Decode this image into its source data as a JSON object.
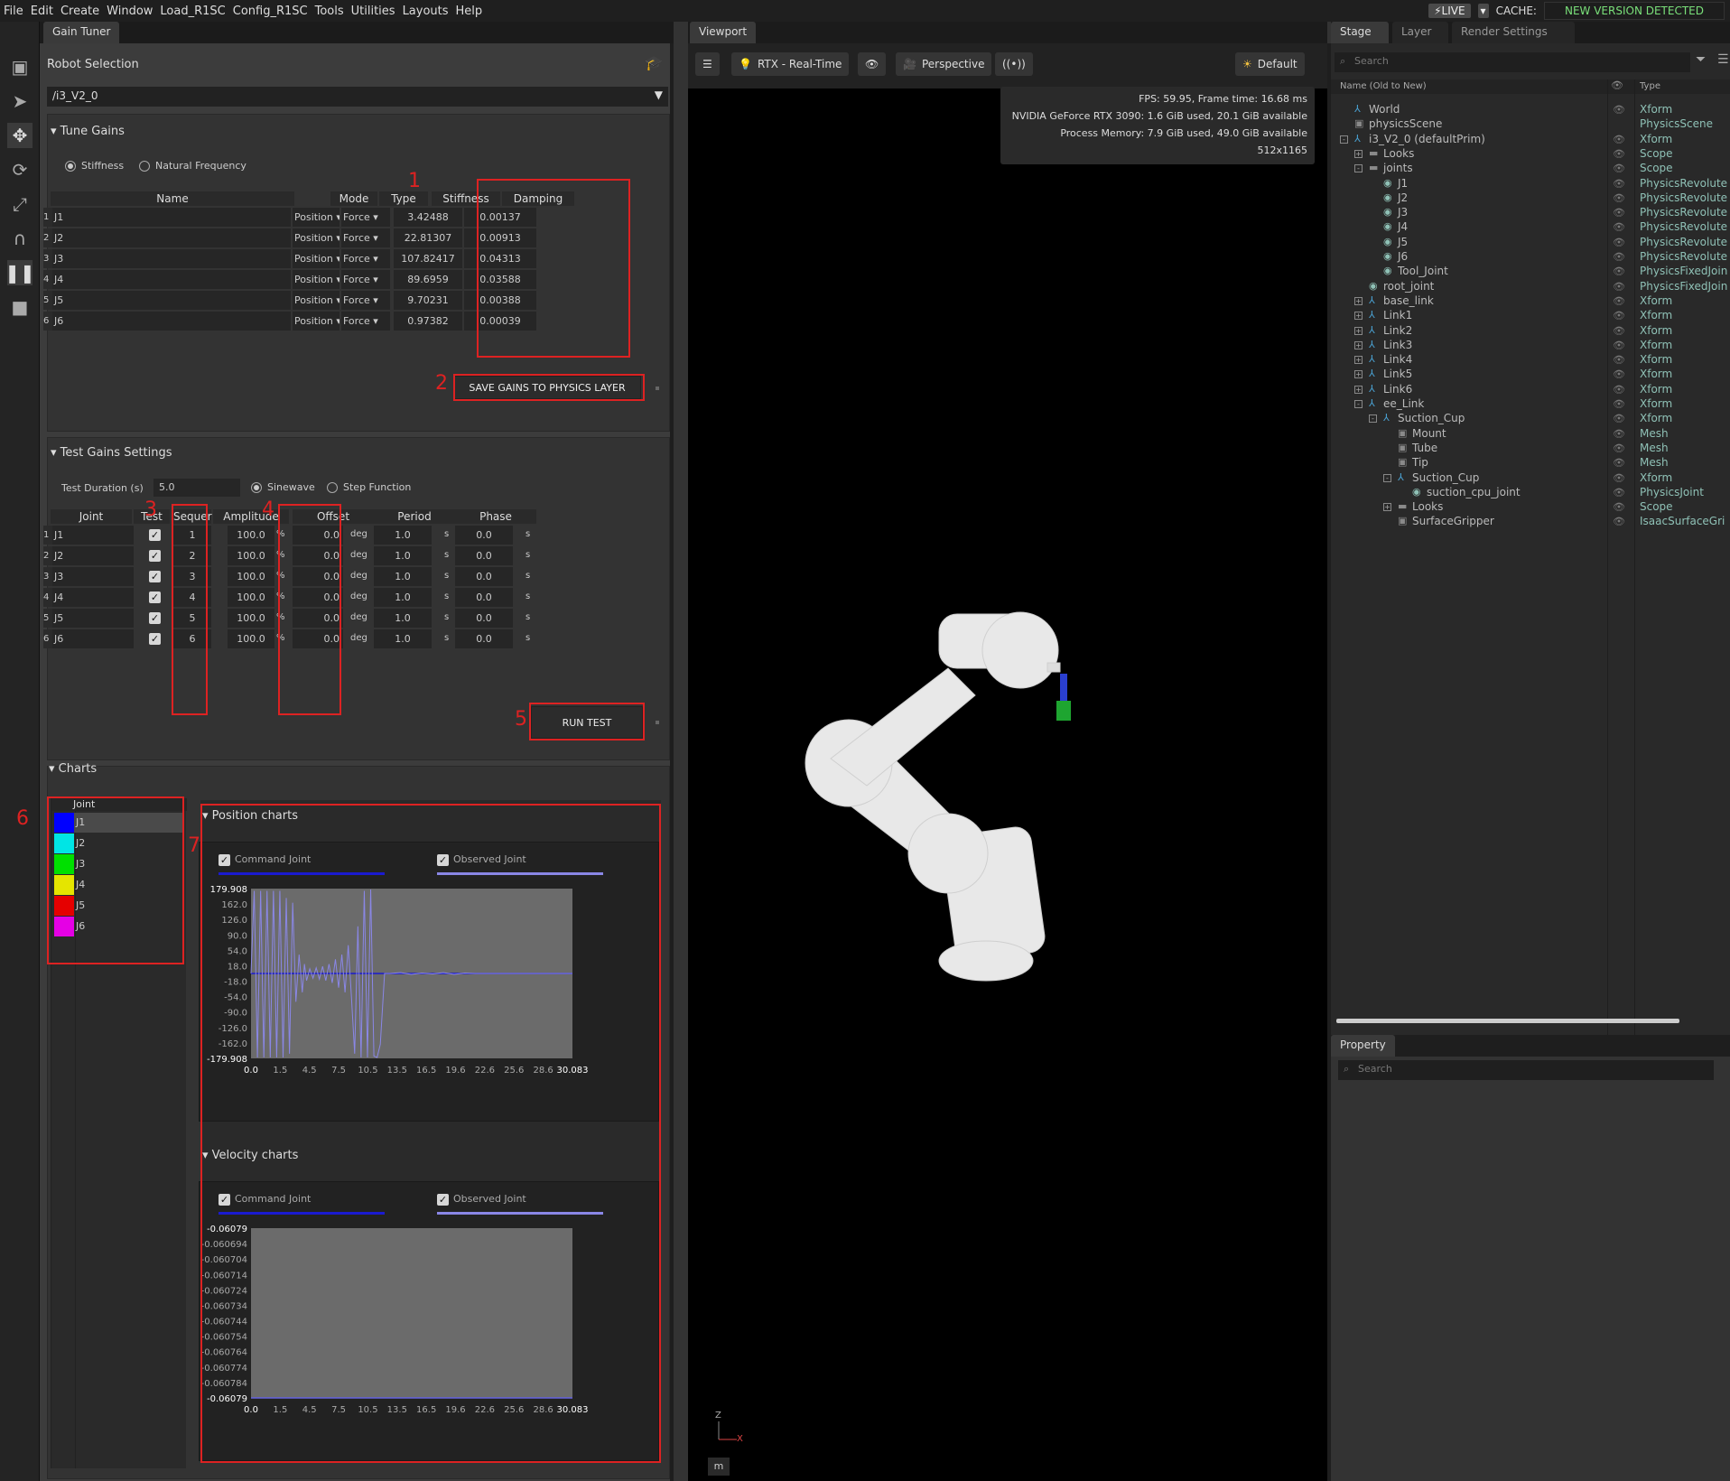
{
  "menu": [
    "File",
    "Edit",
    "Create",
    "Window",
    "Load_R1SC",
    "Config_R1SC",
    "Tools",
    "Utilities",
    "Layouts",
    "Help"
  ],
  "live": {
    "label": "LIVE",
    "cache": "CACHE:",
    "new_version": "NEW VERSION DETECTED"
  },
  "gain_tuner": {
    "tab": "Gain Tuner",
    "robot_selection_label": "Robot Selection",
    "robot": "/i3_V2_0",
    "tune_gains": {
      "title": "Tune Gains",
      "radio_stiffness": "Stiffness",
      "radio_natural": "Natural Frequency",
      "headers": {
        "name": "Name",
        "mode": "Mode",
        "type": "Type",
        "stiffness": "Stiffness",
        "damping": "Damping"
      },
      "rows": [
        {
          "idx": "1",
          "name": "J1",
          "mode": "Position",
          "type": "Force",
          "stiffness": "3.42488",
          "damping": "0.00137"
        },
        {
          "idx": "2",
          "name": "J2",
          "mode": "Position",
          "type": "Force",
          "stiffness": "22.81307",
          "damping": "0.00913"
        },
        {
          "idx": "3",
          "name": "J3",
          "mode": "Position",
          "type": "Force",
          "stiffness": "107.82417",
          "damping": "0.04313"
        },
        {
          "idx": "4",
          "name": "J4",
          "mode": "Position",
          "type": "Force",
          "stiffness": "89.6959",
          "damping": "0.03588"
        },
        {
          "idx": "5",
          "name": "J5",
          "mode": "Position",
          "type": "Force",
          "stiffness": "9.70231",
          "damping": "0.00388"
        },
        {
          "idx": "6",
          "name": "J6",
          "mode": "Position",
          "type": "Force",
          "stiffness": "0.97382",
          "damping": "0.00039"
        }
      ],
      "save_button": "SAVE GAINS TO PHYSICS LAYER"
    },
    "test_gains": {
      "title": "Test Gains Settings",
      "duration_label": "Test Duration (s)",
      "duration": "5.0",
      "radio_sine": "Sinewave",
      "radio_step": "Step Function",
      "headers": {
        "joint": "Joint",
        "test": "Test",
        "sequence": "Sequer",
        "amplitude": "Amplitude",
        "offset": "Offset",
        "period": "Period",
        "phase": "Phase"
      },
      "rows": [
        {
          "idx": "1",
          "joint": "J1",
          "seq": "1",
          "amp": "100.0",
          "amp_unit": "%",
          "offset": "0.0",
          "offset_unit": "deg",
          "period": "1.0",
          "period_unit": "s",
          "phase": "0.0",
          "phase_unit": "s"
        },
        {
          "idx": "2",
          "joint": "J2",
          "seq": "2",
          "amp": "100.0",
          "amp_unit": "%",
          "offset": "0.0",
          "offset_unit": "deg",
          "period": "1.0",
          "period_unit": "s",
          "phase": "0.0",
          "phase_unit": "s"
        },
        {
          "idx": "3",
          "joint": "J3",
          "seq": "3",
          "amp": "100.0",
          "amp_unit": "%",
          "offset": "0.0",
          "offset_unit": "deg",
          "period": "1.0",
          "period_unit": "s",
          "phase": "0.0",
          "phase_unit": "s"
        },
        {
          "idx": "4",
          "joint": "J4",
          "seq": "4",
          "amp": "100.0",
          "amp_unit": "%",
          "offset": "0.0",
          "offset_unit": "deg",
          "period": "1.0",
          "period_unit": "s",
          "phase": "0.0",
          "phase_unit": "s"
        },
        {
          "idx": "5",
          "joint": "J5",
          "seq": "5",
          "amp": "100.0",
          "amp_unit": "%",
          "offset": "0.0",
          "offset_unit": "deg",
          "period": "1.0",
          "period_unit": "s",
          "phase": "0.0",
          "phase_unit": "s"
        },
        {
          "idx": "6",
          "joint": "J6",
          "seq": "6",
          "amp": "100.0",
          "amp_unit": "%",
          "offset": "0.0",
          "offset_unit": "deg",
          "period": "1.0",
          "period_unit": "s",
          "phase": "0.0",
          "phase_unit": "s"
        }
      ],
      "run_button": "RUN TEST"
    },
    "charts": {
      "title": "Charts",
      "joint_header": "Joint",
      "joints": [
        {
          "name": "J1",
          "color": "#0000ff"
        },
        {
          "name": "J2",
          "color": "#00e5e5"
        },
        {
          "name": "J3",
          "color": "#00e000"
        },
        {
          "name": "J4",
          "color": "#e5e500"
        },
        {
          "name": "J5",
          "color": "#e50000"
        },
        {
          "name": "J6",
          "color": "#e500e5"
        }
      ],
      "position_title": "Position charts",
      "velocity_title": "Velocity charts",
      "legend_command": "Command Joint",
      "legend_observed": "Observed Joint"
    },
    "annotations": [
      "1",
      "2",
      "3",
      "4",
      "5",
      "6",
      "7"
    ]
  },
  "chart_data": [
    {
      "type": "line",
      "title": "Position charts",
      "y_max_label": "179.908",
      "y_min_label": "-179.908",
      "y_ticks": [
        "162.0",
        "126.0",
        "90.0",
        "54.0",
        "18.0",
        "-18.0",
        "-54.0",
        "-90.0",
        "-126.0",
        "-162.0"
      ],
      "x_ticks": [
        "0.0",
        "1.5",
        "4.5",
        "7.5",
        "10.5",
        "13.5",
        "16.5",
        "19.6",
        "22.6",
        "25.6",
        "28.6",
        "30.083"
      ],
      "ylim": [
        -179.908,
        179.908
      ],
      "xlim": [
        0.0,
        30.083
      ],
      "series": [
        {
          "name": "Command Joint",
          "color": "#1a1ad0",
          "x": [
            0,
            30.083
          ],
          "y": [
            0,
            0
          ]
        },
        {
          "name": "Observed Joint",
          "color": "#8a87e6",
          "x": [
            0.0,
            0.3,
            0.6,
            0.9,
            1.2,
            1.5,
            1.8,
            2.1,
            2.4,
            2.7,
            3.0,
            3.3,
            3.6,
            3.9,
            4.2,
            4.5,
            4.8,
            5.0,
            5.2,
            5.5,
            5.8,
            6.1,
            6.4,
            6.7,
            7.0,
            7.3,
            7.6,
            7.9,
            8.2,
            8.5,
            8.8,
            9.1,
            9.4,
            9.7,
            10.0,
            10.3,
            10.6,
            10.9,
            11.2,
            11.5,
            11.8,
            12.1,
            12.5,
            13.0,
            14.0,
            15.0,
            16.0,
            17.0,
            18.0,
            19.0,
            20.0,
            21.0,
            22.0,
            23.0,
            24.0,
            25.0,
            26.0,
            27.0,
            28.0,
            29.0,
            30.083
          ],
          "y": [
            0,
            175,
            -178,
            175,
            -178,
            175,
            -178,
            175,
            -178,
            175,
            -178,
            160,
            -170,
            150,
            -60,
            40,
            -40,
            20,
            -15,
            10,
            -10,
            12,
            -12,
            15,
            -15,
            20,
            -20,
            30,
            -30,
            40,
            -40,
            60,
            -50,
            -170,
            100,
            -178,
            175,
            -178,
            178,
            -175,
            -178,
            -150,
            0,
            0,
            2,
            -2,
            1,
            -1,
            2,
            -2,
            1,
            0,
            0,
            0,
            0,
            0,
            0,
            0,
            0,
            0,
            0
          ]
        }
      ]
    },
    {
      "type": "line",
      "title": "Velocity charts",
      "y_max_label": "-0.06079",
      "y_min_label": "-0.06079",
      "y_ticks": [
        "-0.060694",
        "-0.060704",
        "-0.060714",
        "-0.060724",
        "-0.060734",
        "-0.060744",
        "-0.060754",
        "-0.060764",
        "-0.060774",
        "-0.060784"
      ],
      "x_ticks": [
        "0.0",
        "1.5",
        "4.5",
        "7.5",
        "10.5",
        "13.5",
        "16.5",
        "19.6",
        "22.6",
        "25.6",
        "28.6",
        "30.083"
      ],
      "ylim": [
        -0.06079,
        -0.060684
      ],
      "xlim": [
        0.0,
        30.083
      ],
      "series": [
        {
          "name": "Command Joint",
          "color": "#1a1ad0",
          "x": [
            0,
            30.083
          ],
          "y": [
            -0.06079,
            -0.06079
          ]
        },
        {
          "name": "Observed Joint",
          "color": "#8a87e6",
          "x": [
            0,
            30.083
          ],
          "y": [
            -0.06079,
            -0.06079
          ]
        }
      ]
    }
  ],
  "viewport": {
    "tab": "Viewport",
    "renderer": "RTX - Real-Time",
    "camera": "Perspective",
    "lighting": "Default",
    "stats": [
      "FPS: 59.95, Frame time: 16.68 ms",
      "NVIDIA GeForce RTX 3090: 1.6 GiB used, 20.1 GiB available",
      "Process Memory: 7.9 GiB used, 49.0 GiB available",
      "512x1165"
    ],
    "axis_z": "Z",
    "axis_x": "X",
    "unit": "m"
  },
  "stage": {
    "tabs": [
      "Stage",
      "Layer",
      "Render Settings"
    ],
    "search": "Search",
    "col_name": "Name (Old to New)",
    "col_type": "Type",
    "tree": [
      {
        "name": "World",
        "type": "Xform",
        "indent": 0,
        "exp": "",
        "icon": "xform"
      },
      {
        "name": "physicsScene",
        "type": "PhysicsScene",
        "indent": 0,
        "exp": "",
        "icon": "cube"
      },
      {
        "name": "i3_V2_0 (defaultPrim)",
        "type": "Xform",
        "indent": 0,
        "exp": "-",
        "icon": "xform"
      },
      {
        "name": "Looks",
        "type": "Scope",
        "indent": 1,
        "exp": "+",
        "icon": "folder"
      },
      {
        "name": "joints",
        "type": "Scope",
        "indent": 1,
        "exp": "-",
        "icon": "folder"
      },
      {
        "name": "J1",
        "type": "PhysicsRevolute",
        "indent": 2,
        "exp": "",
        "icon": "joint"
      },
      {
        "name": "J2",
        "type": "PhysicsRevolute",
        "indent": 2,
        "exp": "",
        "icon": "joint"
      },
      {
        "name": "J3",
        "type": "PhysicsRevolute",
        "indent": 2,
        "exp": "",
        "icon": "joint"
      },
      {
        "name": "J4",
        "type": "PhysicsRevolute",
        "indent": 2,
        "exp": "",
        "icon": "joint"
      },
      {
        "name": "J5",
        "type": "PhysicsRevolute",
        "indent": 2,
        "exp": "",
        "icon": "joint"
      },
      {
        "name": "J6",
        "type": "PhysicsRevolute",
        "indent": 2,
        "exp": "",
        "icon": "joint"
      },
      {
        "name": "Tool_Joint",
        "type": "PhysicsFixedJoin",
        "indent": 2,
        "exp": "",
        "icon": "joint"
      },
      {
        "name": "root_joint",
        "type": "PhysicsFixedJoin",
        "indent": 1,
        "exp": "",
        "icon": "joint"
      },
      {
        "name": "base_link",
        "type": "Xform",
        "indent": 1,
        "exp": "+",
        "icon": "xform"
      },
      {
        "name": "Link1",
        "type": "Xform",
        "indent": 1,
        "exp": "+",
        "icon": "xform"
      },
      {
        "name": "Link2",
        "type": "Xform",
        "indent": 1,
        "exp": "+",
        "icon": "xform"
      },
      {
        "name": "Link3",
        "type": "Xform",
        "indent": 1,
        "exp": "+",
        "icon": "xform"
      },
      {
        "name": "Link4",
        "type": "Xform",
        "indent": 1,
        "exp": "+",
        "icon": "xform"
      },
      {
        "name": "Link5",
        "type": "Xform",
        "indent": 1,
        "exp": "+",
        "icon": "xform"
      },
      {
        "name": "Link6",
        "type": "Xform",
        "indent": 1,
        "exp": "+",
        "icon": "xform"
      },
      {
        "name": "ee_Link",
        "type": "Xform",
        "indent": 1,
        "exp": "-",
        "icon": "xform"
      },
      {
        "name": "Suction_Cup",
        "type": "Xform",
        "indent": 2,
        "exp": "-",
        "icon": "xform2"
      },
      {
        "name": "Mount",
        "type": "Mesh",
        "indent": 3,
        "exp": "",
        "icon": "cube"
      },
      {
        "name": "Tube",
        "type": "Mesh",
        "indent": 3,
        "exp": "",
        "icon": "cube"
      },
      {
        "name": "Tip",
        "type": "Mesh",
        "indent": 3,
        "exp": "",
        "icon": "cube"
      },
      {
        "name": "Suction_Cup",
        "type": "Xform",
        "indent": 3,
        "exp": "-",
        "icon": "xform"
      },
      {
        "name": "suction_cpu_joint",
        "type": "PhysicsJoint",
        "indent": 4,
        "exp": "",
        "icon": "joint"
      },
      {
        "name": "Looks",
        "type": "Scope",
        "indent": 3,
        "exp": "+",
        "icon": "folder"
      },
      {
        "name": "SurfaceGripper",
        "type": "IsaacSurfaceGri",
        "indent": 3,
        "exp": "",
        "icon": "cube"
      }
    ],
    "property_tab": "Property",
    "property_search": "Search"
  }
}
